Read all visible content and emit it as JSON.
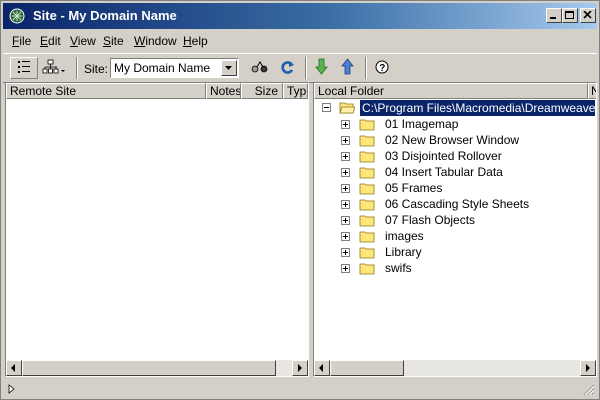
{
  "window": {
    "title": "Site - My Domain Name"
  },
  "menu": [
    {
      "pre": "",
      "u": "F",
      "post": "ile"
    },
    {
      "pre": "",
      "u": "E",
      "post": "dit"
    },
    {
      "pre": "",
      "u": "V",
      "post": "iew"
    },
    {
      "pre": "",
      "u": "S",
      "post": "ite"
    },
    {
      "pre": "",
      "u": "W",
      "post": "indow"
    },
    {
      "pre": "",
      "u": "H",
      "post": "elp"
    }
  ],
  "toolbar": {
    "site_label": "Site:",
    "site_value": "My Domain Name"
  },
  "remote_pane": {
    "columns": [
      "Remote Site",
      "Notes",
      "Size",
      "Type"
    ]
  },
  "local_pane": {
    "columns": [
      "Local Folder",
      "N"
    ],
    "root": "C:\\Program Files\\Macromedia\\Dreamweaver ...",
    "items": [
      "01 Imagemap",
      "02 New Browser Window",
      "03 Disjointed Rollover",
      "04 Insert Tabular Data",
      "05 Frames",
      "06 Cascading Style Sheets",
      "07 Flash Objects",
      "images",
      "Library",
      "swifs"
    ]
  },
  "colors": {
    "title_active": "#0a246a",
    "selection": "#0a246a",
    "folder": "#ffe77a"
  }
}
